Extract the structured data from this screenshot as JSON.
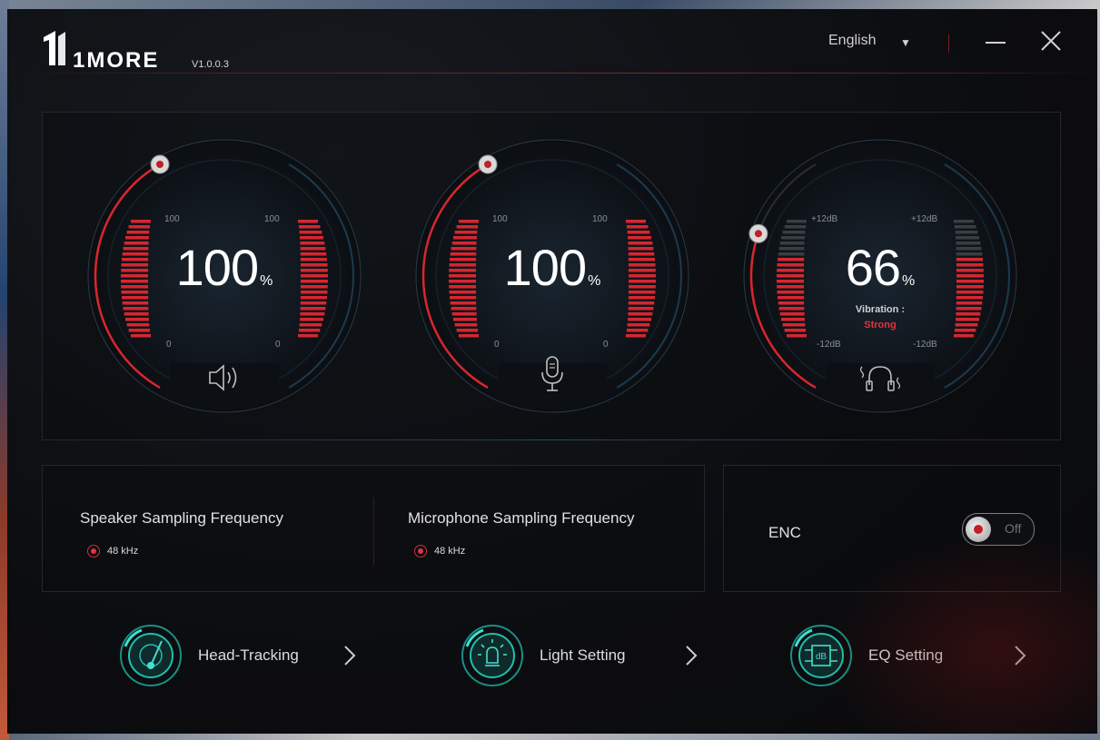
{
  "app": {
    "version": "V1.0.0.3"
  },
  "header": {
    "language": "English"
  },
  "dials": [
    {
      "value": "100",
      "unit": "%",
      "level": 1.0,
      "tick_top": "100",
      "tick_bottom": "0",
      "icon": "speaker-icon"
    },
    {
      "value": "100",
      "unit": "%",
      "level": 1.0,
      "tick_top": "100",
      "tick_bottom": "0",
      "icon": "microphone-icon"
    },
    {
      "value": "66",
      "unit": "%",
      "level": 0.66,
      "tick_top": "+12dB",
      "tick_bottom": "-12dB",
      "icon": "headphones-vibration-icon",
      "vibration_label": "Vibration :",
      "vibration_value": "Strong"
    }
  ],
  "sampling": {
    "speaker_title": "Speaker Sampling Frequency",
    "speaker_option": "48 kHz",
    "mic_title": "Microphone Sampling Frequency",
    "mic_option": "48 kHz"
  },
  "enc": {
    "label": "ENC",
    "state": "Off"
  },
  "nav": [
    {
      "label": "Head-Tracking",
      "icon": "radar-icon"
    },
    {
      "label": "Light Setting",
      "icon": "light-bulb-icon"
    },
    {
      "label": "EQ Setting",
      "icon": "db-equalizer-icon"
    }
  ],
  "colors": {
    "accent_red": "#e0343c",
    "teal": "#1fbfae",
    "background": "#0c0d10"
  }
}
